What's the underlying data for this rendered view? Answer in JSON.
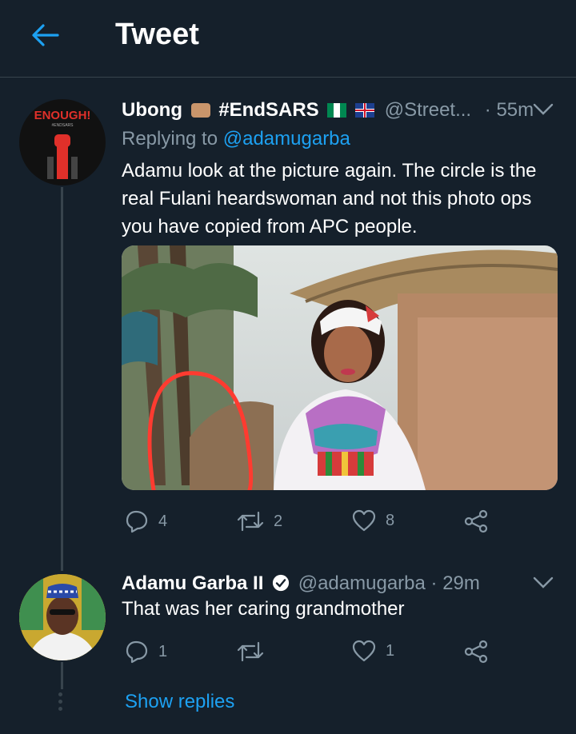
{
  "header": {
    "title": "Tweet"
  },
  "tweet1": {
    "author": "Ubong",
    "hashtag": "#EndSARS",
    "handle": "@Street...",
    "time": "· 55m",
    "reply_label": "Replying to",
    "reply_to": "@adamugarba",
    "text": "Adamu look at the picture again. The circle is the real Fulani heardswoman and not this photo ops you have copied from APC people.",
    "avatar_text": "ENOUGH!",
    "avatar_subtext": "#ENDSARS",
    "reply_count": "4",
    "retweet_count": "2",
    "like_count": "8"
  },
  "tweet2": {
    "author": "Adamu Garba II",
    "handle": "@adamugarba",
    "time": "· 29m",
    "text": "That was her caring grandmother",
    "reply_count": "1",
    "retweet_count": "",
    "like_count": "1"
  },
  "show_replies": "Show replies",
  "icons": [
    "back-arrow-icon",
    "chevron-down-icon",
    "reply-icon",
    "retweet-icon",
    "like-icon",
    "share-icon",
    "verified-icon",
    "fist-emoji-icon",
    "nigeria-flag-icon",
    "uk-flag-icon"
  ],
  "colors": {
    "background": "#15202b",
    "accent": "#1da1f2",
    "muted": "#8899a6",
    "divider": "#38444d"
  }
}
